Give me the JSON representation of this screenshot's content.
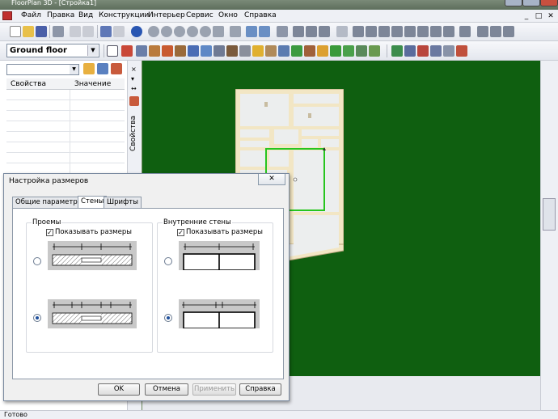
{
  "window": {
    "title": "FloorPlan 3D - [Стройка1]"
  },
  "menu": [
    "Файл",
    "Правка",
    "Вид",
    "Конструкции",
    "Интерьер",
    "Сервис",
    "Окно",
    "Справка"
  ],
  "mdi_buttons": [
    "_",
    "□",
    "✕"
  ],
  "floor_select": {
    "value": "Ground floor"
  },
  "left_panel": {
    "col_property": "Свойства",
    "col_value": "Значение"
  },
  "side_tab": {
    "label": "Свойства",
    "pin": "▾",
    "close": "×",
    "arrows": "↔"
  },
  "status": {
    "text": "Готово"
  },
  "dialog": {
    "title": "Настройка размеров",
    "close": "✕",
    "tabs": [
      "Общие параметры",
      "Стены",
      "Шрифты"
    ],
    "active_tab": 1,
    "group_openings": {
      "label": "Проемы",
      "checkbox": "Показывать размеры",
      "checked": true
    },
    "group_inner": {
      "label": "Внутренние стены",
      "checkbox": "Показывать размеры",
      "checked": true
    },
    "buttons": {
      "ok": "OK",
      "cancel": "Отмена",
      "apply": "Применить",
      "help": "Справка"
    }
  },
  "colors": {
    "canvas": "#0f5f10",
    "selection": "#27c51e",
    "wall": "#f2e6c4"
  }
}
